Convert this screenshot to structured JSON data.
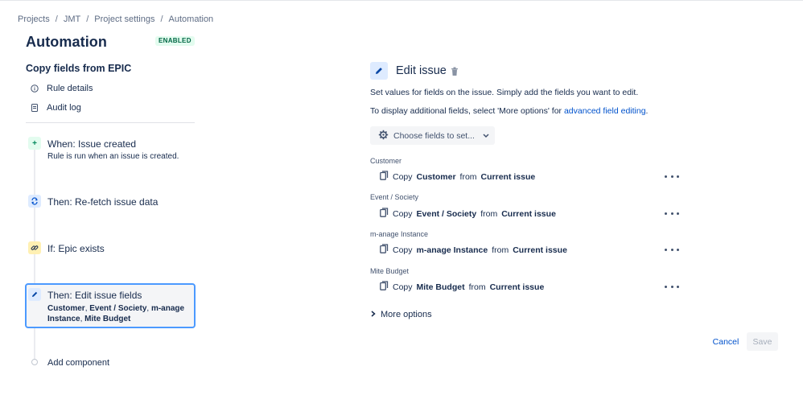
{
  "breadcrumb": [
    "Projects",
    "JMT",
    "Project settings",
    "Automation"
  ],
  "page": {
    "title": "Automation",
    "status": "ENABLED"
  },
  "rule": {
    "name": "Copy fields from EPIC",
    "links": [
      {
        "label": "Rule details",
        "icon": "info-icon"
      },
      {
        "label": "Audit log",
        "icon": "document-icon"
      }
    ]
  },
  "components": {
    "trigger": {
      "title": "When: Issue created",
      "desc": "Rule is run when an issue is created.",
      "icon_glyph": "+"
    },
    "refetch": {
      "title": "Then: Re-fetch issue data"
    },
    "condition": {
      "title": "If: Epic exists"
    },
    "edit": {
      "title": "Then: Edit issue fields",
      "fields": [
        "Customer",
        ", ",
        "Event / Society",
        ", ",
        "m-anage",
        "Instance",
        ", ",
        "Mite Budget"
      ]
    },
    "add_label": "Add component"
  },
  "panel": {
    "title": "Edit issue",
    "help1": "Set values for fields on the issue. Simply add the fields you want to edit.",
    "help2_prefix": "To display additional fields, select 'More options' for ",
    "help2_link": "advanced field editing",
    "help2_suffix": ".",
    "choose_label": "Choose fields to set...",
    "fields": [
      {
        "label": "Customer",
        "copy": "Copy",
        "field": "Customer",
        "from": "from",
        "source": "Current issue"
      },
      {
        "label": "Event / Society",
        "copy": "Copy",
        "field": "Event / Society",
        "from": "from",
        "source": "Current issue"
      },
      {
        "label": "m-anage Instance",
        "copy": "Copy",
        "field": "m-anage Instance",
        "from": "from",
        "source": "Current issue"
      },
      {
        "label": "Mite Budget",
        "copy": "Copy",
        "field": "Mite Budget",
        "from": "from",
        "source": "Current issue"
      }
    ],
    "more_options": "More options",
    "cancel": "Cancel",
    "save": "Save"
  },
  "colors": {
    "accent": "#0052cc",
    "selected_border": "#4c9aff",
    "enabled_bg": "#e3fcef",
    "enabled_text": "#006644"
  }
}
